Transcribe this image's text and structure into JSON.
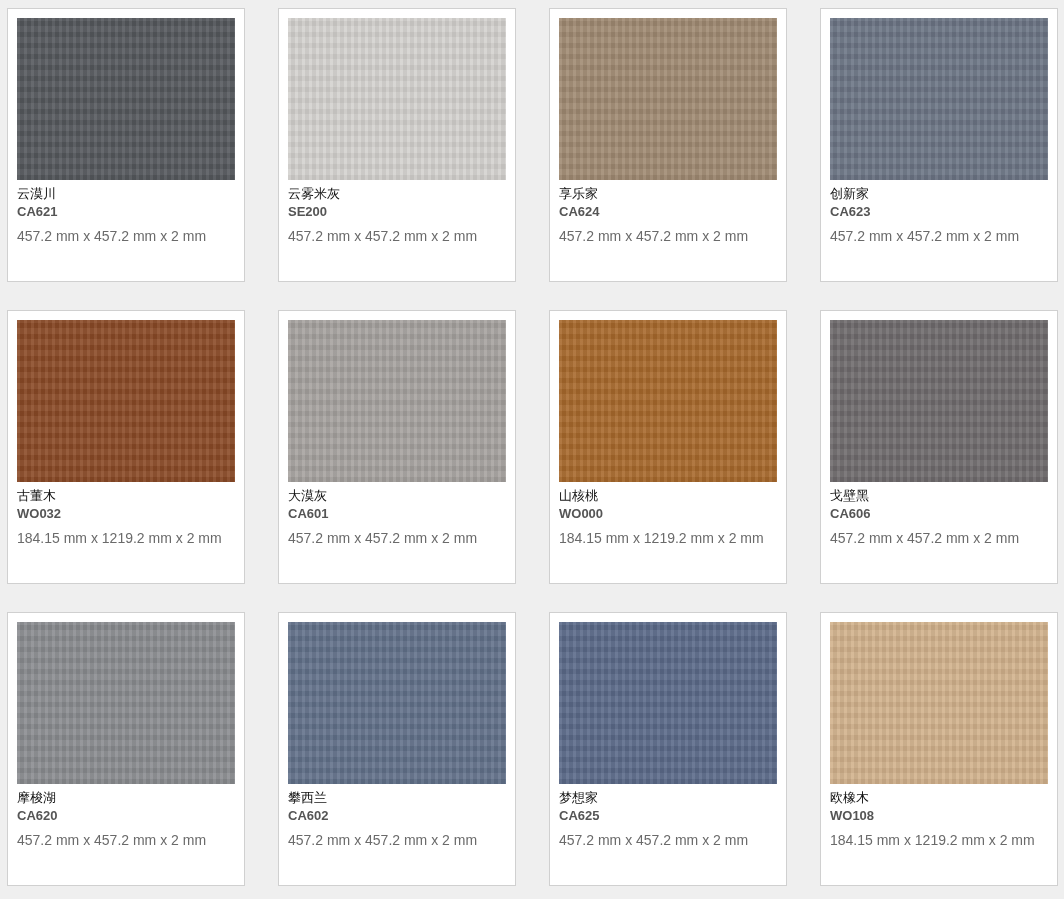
{
  "products": [
    {
      "name": "云漠川",
      "code": "CA621",
      "size": "457.2 mm x 457.2 mm x 2 mm",
      "color": "#55585d"
    },
    {
      "name": "云雾米灰",
      "code": "SE200",
      "size": "457.2 mm x 457.2 mm x 2 mm",
      "color": "#d4d2cf"
    },
    {
      "name": "享乐家",
      "code": "CA624",
      "size": "457.2 mm x 457.2 mm x 2 mm",
      "color": "#a08a72"
    },
    {
      "name": "创新家",
      "code": "CA623",
      "size": "457.2 mm x 457.2 mm x 2 mm",
      "color": "#6c7585"
    },
    {
      "name": "古董木",
      "code": "WO032",
      "size": "184.15 mm x 1219.2 mm x 2 mm",
      "color": "#8a4a26"
    },
    {
      "name": "大漠灰",
      "code": "CA601",
      "size": "457.2 mm x 457.2 mm x 2 mm",
      "color": "#a6a29f"
    },
    {
      "name": "山核桃",
      "code": "WO000",
      "size": "184.15 mm x 1219.2 mm x 2 mm",
      "color": "#a8692c"
    },
    {
      "name": "戈壁黑",
      "code": "CA606",
      "size": "457.2 mm x 457.2 mm x 2 mm",
      "color": "#6f6b6d"
    },
    {
      "name": "摩梭湖",
      "code": "CA620",
      "size": "457.2 mm x 457.2 mm x 2 mm",
      "color": "#8a8c90"
    },
    {
      "name": "攀西兰",
      "code": "CA602",
      "size": "457.2 mm x 457.2 mm x 2 mm",
      "color": "#62718a"
    },
    {
      "name": "梦想家",
      "code": "CA625",
      "size": "457.2 mm x 457.2 mm x 2 mm",
      "color": "#5b6a89"
    },
    {
      "name": "欧橡木",
      "code": "WO108",
      "size": "184.15 mm x 1219.2 mm x 2 mm",
      "color": "#d2b28c"
    }
  ]
}
